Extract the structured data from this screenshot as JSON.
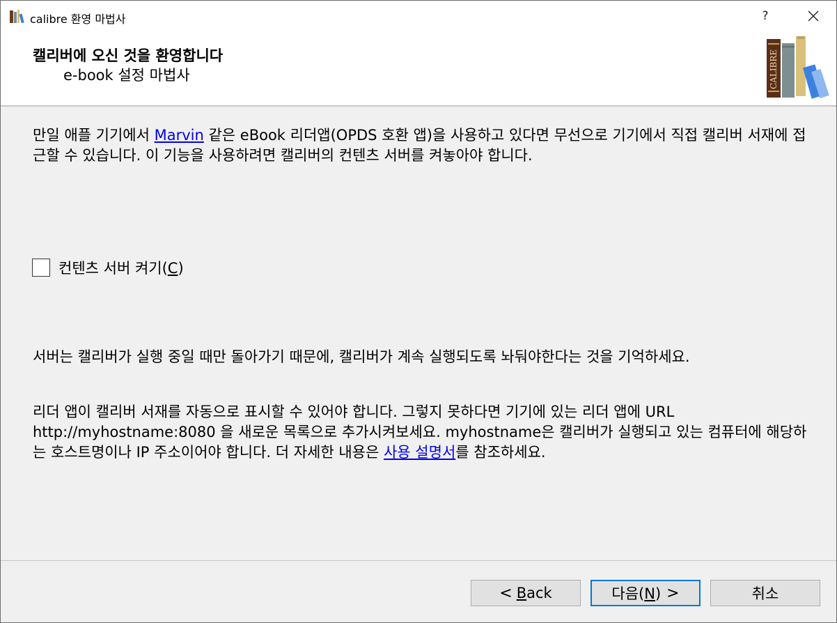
{
  "window": {
    "title": "calibre 환영 마법사",
    "help_label": "?"
  },
  "header": {
    "title": "캘리버에 오신 것을 환영합니다",
    "subtitle": "e-book 설정 마법사",
    "logo_text": "CALIBRE"
  },
  "intro": {
    "text_before_link": "만일 애플 기기에서 ",
    "link_text": "Marvin",
    "text_after_link": " 같은 eBook 리더앱(OPDS 호환 앱)을 사용하고 있다면 무선으로 기기에서 직접 캘리버 서재에 접근할 수 있습니다. 이 기능을 사용하려면 캘리버의 컨텐츠 서버를 켜놓아야 합니다."
  },
  "checkbox": {
    "label_before": "컨텐츠 서버 켜기(",
    "mnemonic": "C",
    "label_after": ")",
    "checked": false
  },
  "note1": "서버는 캘리버가 실행 중일 때만 돌아가기 때문에, 캘리버가 계속 실행되도록 놔둬야한다는 것을 기억하세요.",
  "note2": {
    "text_before_link": "리더 앱이 캘리버 서재를 자동으로 표시할 수 있어야 합니다. 그렇지 못하다면 기기에 있는 리더 앱에 URL http://myhostname:8080 을 새로운 목록으로 추가시켜보세요. myhostname은 캘리버가 실행되고 있는 컴퓨터에 해당하는 호스트명이나 IP 주소이어야 합니다. 더 자세한 내용은 ",
    "link_text": "사용 설명서",
    "text_after_link": "를 참조하세요."
  },
  "buttons": {
    "back_chevron": "<",
    "back_mnemonic": "B",
    "back_rest": "ack",
    "next_label_before": "다음(",
    "next_mnemonic": "N",
    "next_label_after": ")",
    "next_chevron": ">",
    "cancel_label": "취소"
  },
  "colors": {
    "link": "#0000ee",
    "primary_button_border": "#0078d7",
    "dialog_background": "#f0f0f0"
  },
  "icons": {
    "app": "calibre-books-icon",
    "close": "close-icon",
    "logo": "calibre-logo"
  }
}
